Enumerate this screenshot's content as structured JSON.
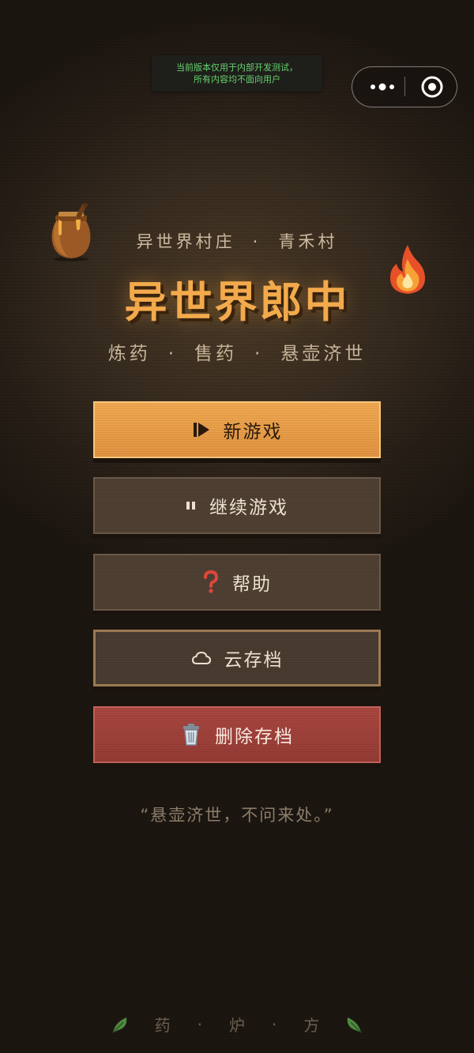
{
  "dev_notice": {
    "line1": "当前版本仅用于内部开发测试，",
    "line2": "所有内容均不面向用户"
  },
  "capsule": {
    "more_icon": "more-dots-icon",
    "close_icon": "target-circle-icon"
  },
  "header": {
    "subtitle_left": "异世界村庄",
    "subtitle_sep": "·",
    "subtitle_right": "青禾村",
    "title": "异世界郎中",
    "tagline": [
      "炼药",
      "·",
      "售药",
      "·",
      "悬壶济世"
    ]
  },
  "decor": {
    "left": "clay-pot-icon",
    "right": "fire-icon"
  },
  "menu": {
    "new_game": {
      "label": "新游戏",
      "icon": "play-icon"
    },
    "continue_game": {
      "label": "继续游戏",
      "icon": "pause-icon"
    },
    "help": {
      "label": "帮助",
      "icon": "question-icon"
    },
    "cloud_save": {
      "label": "云存档",
      "icon": "cloud-icon"
    },
    "delete_save": {
      "label": "删除存档",
      "icon": "trash-icon"
    }
  },
  "quote": "“悬壶济世，不问来处。”",
  "footer": {
    "items": [
      "药",
      "·",
      "炉",
      "·",
      "方"
    ],
    "icon": "herb-leaf-icon"
  },
  "colors": {
    "accent": "#f0a850",
    "title": "#f3aa4c",
    "danger": "#a94740",
    "dev_text": "#67d36f"
  }
}
